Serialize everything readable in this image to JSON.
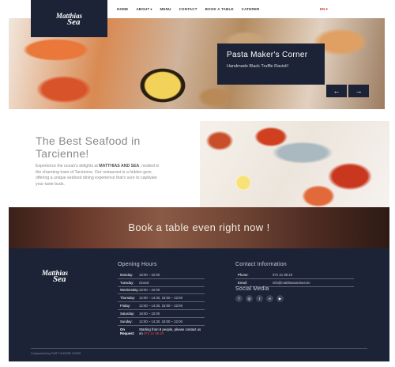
{
  "brand": {
    "name_top": "Matthias",
    "name_bottom": "Sea"
  },
  "nav": {
    "items": [
      {
        "label": "HOME",
        "caret": ""
      },
      {
        "label": "ABOUT",
        "caret": "▾"
      },
      {
        "label": "MENU",
        "caret": ""
      },
      {
        "label": "CONTACT",
        "caret": ""
      },
      {
        "label": "BOOK A TABLE",
        "caret": ""
      },
      {
        "label": "CATERER",
        "caret": ""
      }
    ],
    "language": "EN ▾"
  },
  "hero": {
    "title": "Pasta Maker's Corner",
    "subtitle": "Handmade Black Truffle Ravioli!",
    "prev": "←",
    "next": "→"
  },
  "intro": {
    "title": "The Best Seafood in Tarcienne!",
    "text_before": "Experience the ocean's delights at ",
    "brand_bold": "MATTHIAS AND SEA",
    "text_after": ", nestled in the charming town of Tarcienne. Our restaurant is a hidden gem, offering a unique seafood dining experience that's sure to captivate your taste buds."
  },
  "banner": {
    "text": "Book a table even right now !"
  },
  "footer": {
    "hours_title": "Opening Hours",
    "hours": [
      {
        "day": "Monday:",
        "time": "18:00 – 22:00"
      },
      {
        "day": "Tuesday:",
        "time": "closed"
      },
      {
        "day": "Wednesday:",
        "time": "18:00 – 22:00"
      },
      {
        "day": "Thursday:",
        "time": "12:00 – 14:30, 18:00 – 22:00"
      },
      {
        "day": "Friday:",
        "time": "12:00 – 14:30, 18:00 – 22:00"
      },
      {
        "day": "Saturday:",
        "time": "18:00 – 22:00"
      },
      {
        "day": "Sunday:",
        "time": "12:00 – 14:30, 18:00 – 22:00"
      }
    ],
    "request": {
      "day": "On Request:",
      "text": "Starting from 8 people, please contact us on",
      "phone": "071 21 88 20"
    },
    "contact_title": "Contact Information",
    "contact": [
      {
        "key": "Phone:",
        "value": "071 21 88 20"
      },
      {
        "key": "Email:",
        "value": "info@matthiasandsea.be"
      }
    ],
    "social_title": "Social Media",
    "social": [
      {
        "icon": "facebook-icon",
        "glyph": "f"
      },
      {
        "icon": "instagram-icon",
        "glyph": "◎"
      },
      {
        "icon": "twitter-icon",
        "glyph": "t"
      },
      {
        "icon": "tripadvisor-icon",
        "glyph": "∞"
      },
      {
        "icon": "youtube-icon",
        "glyph": "▶"
      }
    ],
    "credit": "Customized by FAST CHOISE 2023©"
  }
}
